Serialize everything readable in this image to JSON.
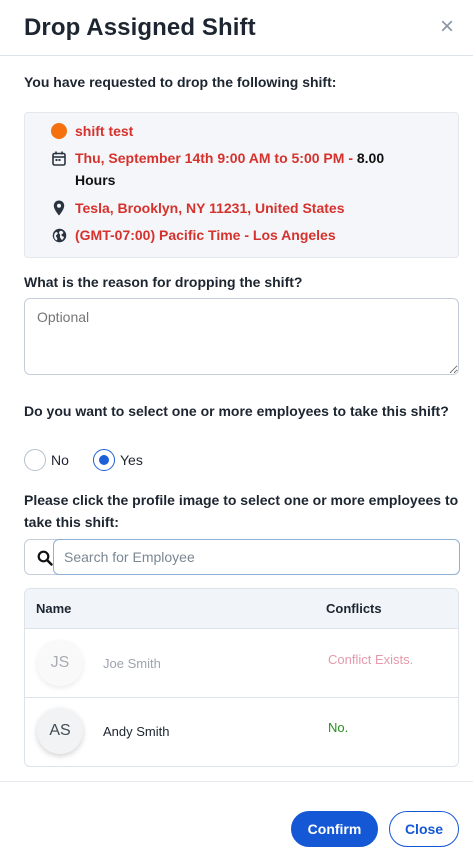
{
  "dialog": {
    "title": "Drop Assigned Shift",
    "close_icon": "close-icon"
  },
  "shift": {
    "intro": "You have requested to drop the following shift:",
    "name": "shift test",
    "date_time": "Thu, September 14th 9:00 AM to 5:00 PM -",
    "hours_value": "8.00",
    "hours_unit": "Hours",
    "location": "Tesla, Brooklyn, NY 11231, United States",
    "timezone": "(GMT-07:00) Pacific Time - Los Angeles",
    "dot_color": "#f5700f",
    "accent_color": "#d6322d",
    "icons": [
      "status-dot-icon",
      "calendar-icon",
      "map-pin-icon",
      "globe-icon"
    ]
  },
  "reason": {
    "question": "What is the reason for dropping the shift?",
    "placeholder": "Optional",
    "value": ""
  },
  "select_employees": {
    "question": "Do you want to select one or more employees to take this shift?",
    "options": [
      {
        "label": "No",
        "selected": false
      },
      {
        "label": "Yes",
        "selected": true
      }
    ]
  },
  "employees": {
    "instruction": "Please click the profile image to select one or more employees to take this shift:",
    "search_placeholder": "Search for Employee",
    "search_icon": "search-icon",
    "columns": [
      "Name",
      "Conflicts"
    ],
    "rows": [
      {
        "initials": "JS",
        "name": "Joe Smith",
        "conflicts": "Conflict Exists.",
        "disabled": true
      },
      {
        "initials": "AS",
        "name": "Andy Smith",
        "conflicts": "No.",
        "disabled": false
      }
    ]
  },
  "footer": {
    "confirm_label": "Confirm",
    "close_label": "Close",
    "primary_color": "#1558d6"
  }
}
